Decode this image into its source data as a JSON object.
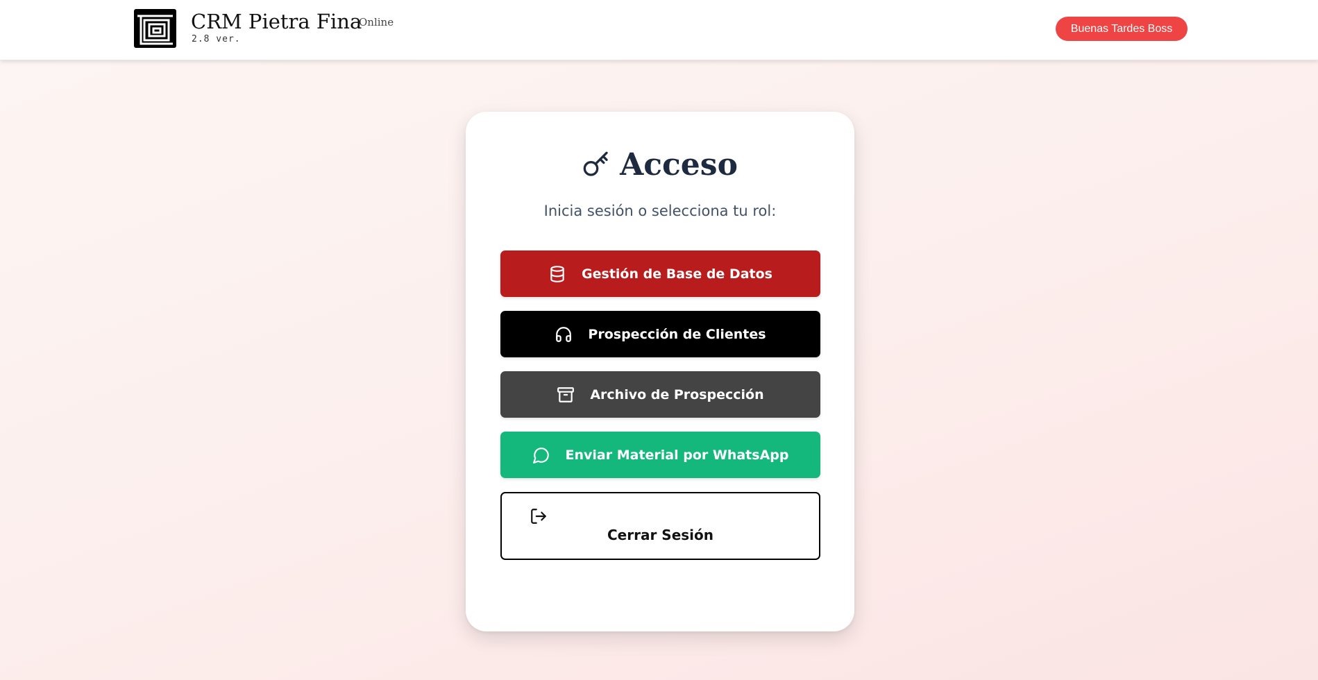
{
  "header": {
    "brand_title": "CRM Pietra Fina",
    "brand_status": "Online",
    "brand_version": "2.8 ver.",
    "greeting": "Buenas Tardes Boss",
    "logo_icon": "maze-logo-icon"
  },
  "login": {
    "title": "Acceso",
    "title_icon": "key-icon",
    "subtitle": "Inicia sesión o selecciona tu rol:",
    "buttons": [
      {
        "label": "Gestión de Base de Datos",
        "icon": "database-icon",
        "color": "#b91c1c"
      },
      {
        "label": "Prospección de Clientes",
        "icon": "headphones-icon",
        "color": "#000000"
      },
      {
        "label": "Archivo de Prospección",
        "icon": "archive-icon",
        "color": "#444444"
      },
      {
        "label": "Enviar Material por WhatsApp",
        "icon": "message-circle-icon",
        "color": "#14b87d"
      }
    ],
    "logout": {
      "label": "Cerrar Sesión",
      "icon": "log-out-icon"
    }
  },
  "colors": {
    "accent": "#ef4444",
    "title_text": "#1e2a3f",
    "subtitle_text": "#42516a"
  }
}
